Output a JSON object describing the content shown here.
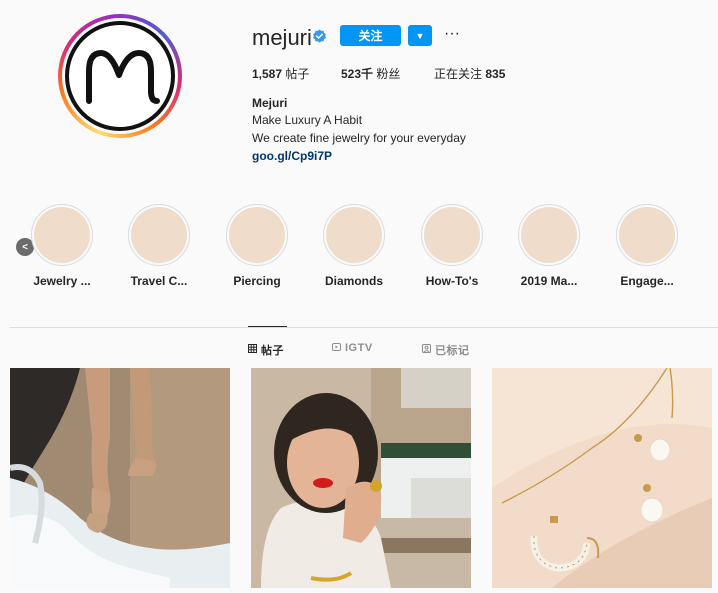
{
  "profile": {
    "username": "mejuri",
    "follow_label": "关注",
    "more_label": "···",
    "stats": {
      "posts_value": "1,587",
      "posts_label": "帖子",
      "followers_value": "523千",
      "followers_label": "粉丝",
      "following_label": "正在关注",
      "following_value": "835"
    },
    "full_name": "Mejuri",
    "bio_line1": "Make Luxury A Habit",
    "bio_line2": "We create fine jewelry for your everyday",
    "link": "goo.gl/Cp9i7P"
  },
  "highlights": [
    {
      "label": "Jewelry ..."
    },
    {
      "label": "Travel C..."
    },
    {
      "label": "Piercing"
    },
    {
      "label": "Diamonds"
    },
    {
      "label": "How-To's"
    },
    {
      "label": "2019 Ma..."
    },
    {
      "label": "Engage..."
    }
  ],
  "tabs": [
    {
      "label": "帖子",
      "icon": "grid-icon",
      "active": true
    },
    {
      "label": "IGTV",
      "icon": "igtv-icon",
      "active": false
    },
    {
      "label": "已标记",
      "icon": "tagged-icon",
      "active": false
    }
  ],
  "colors": {
    "accent": "#0095f6",
    "link": "#00376b",
    "highlight_fill": "#efdccb"
  }
}
